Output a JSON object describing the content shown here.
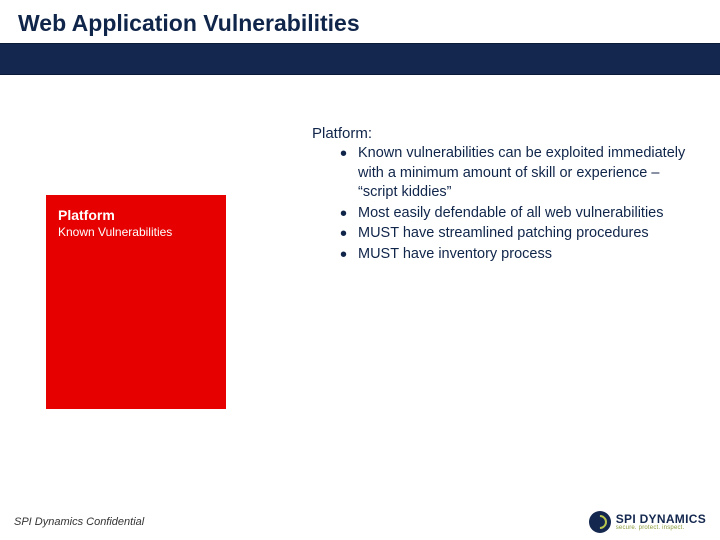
{
  "title": "Web Application Vulnerabilities",
  "redbox": {
    "heading": "Platform",
    "sub": "Known Vulnerabilities"
  },
  "section": {
    "label": "Platform:",
    "bullets": [
      "Known vulnerabilities can be exploited immediately with a minimum amount of skill or experience – “script kiddies”",
      "Most easily defendable of all web vulnerabilities",
      "MUST have streamlined patching procedures",
      "MUST have inventory process"
    ]
  },
  "footer": {
    "confidential": "SPI Dynamics Confidential",
    "logo_name": "SPI DYNAMICS",
    "logo_tag": "secure. protect. inspect."
  }
}
